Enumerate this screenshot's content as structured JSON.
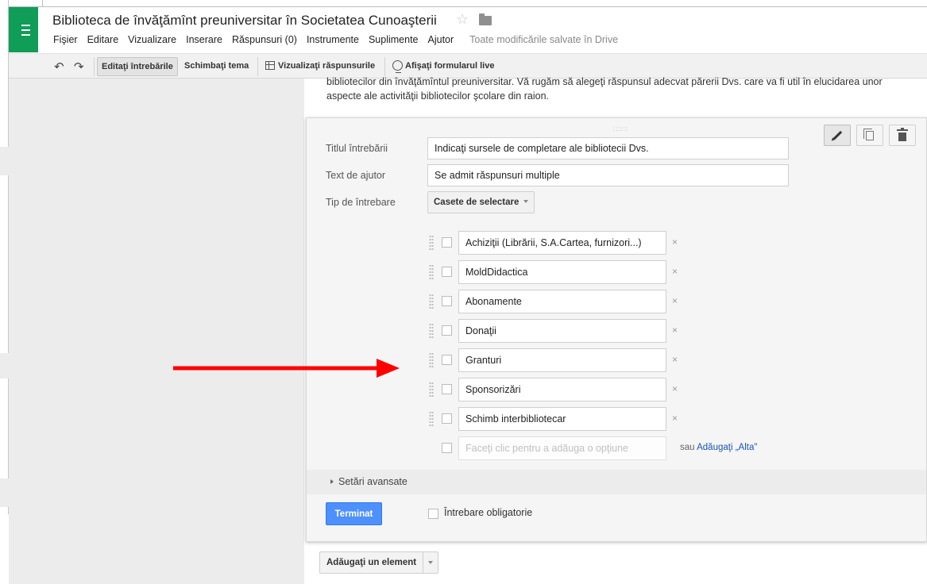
{
  "app": {
    "title": "Biblioteca de învăţămînt preuniversitar în Societatea Cunoaşterii",
    "star_glyph": "☆",
    "save_status": "Toate modificările salvate în Drive",
    "accent_color": "#0f9d58"
  },
  "menu": [
    "Fişier",
    "Editare",
    "Vizualizare",
    "Inserare",
    "Răspunsuri (0)",
    "Instrumente",
    "Suplimente",
    "Ajutor"
  ],
  "toolbar": {
    "undo_glyph": "↶",
    "redo_glyph": "↷",
    "edit_questions": "Editaţi întrebările",
    "change_theme": "Schimbaţi tema",
    "view_responses": "Vizualizaţi răspunsurile",
    "show_live_form": "Afişaţi formularul live"
  },
  "form": {
    "description_line1": "bibliotecilor din învăţămîntul preuniversitar. Vă rugăm să alegeţi răspunsul adecvat părerii Dvs. care va fi util în elucidarea unor",
    "description_line2": "aspecte ale  activităţii bibliotecilor  şcolare din raion."
  },
  "question": {
    "drag_glyph": "::::::",
    "title_label": "Titlul întrebării",
    "title_value": "Indicaţi sursele de completare ale  bibliotecii Dvs.",
    "help_label": "Text de ajutor",
    "help_value": "Se admit răspunsuri multiple",
    "type_label": "Tip de întrebare",
    "type_value": "Casete de selectare",
    "options": [
      "Achiziţii (Librării, S.A.Cartea, furnizori...)",
      "MoldDidactica",
      "Abonamente",
      "Donaţii",
      "Granturi",
      "Sponsorizări",
      "Schimb interbibliotecar"
    ],
    "remove_glyph": "×",
    "add_option_placeholder": "Faceţi clic pentru a adăuga o opţiune",
    "or_text": "sau",
    "add_other_link": "Adăugaţi „Alta\"",
    "advanced_settings": "Setări avansate",
    "done_button": "Terminat",
    "required_label": "Întrebare obligatorie",
    "primary_button_color": "#4d90fe"
  },
  "add_item": {
    "label": "Adăugaţi un element"
  },
  "annotation": {
    "arrow_color": "#ff0000"
  }
}
